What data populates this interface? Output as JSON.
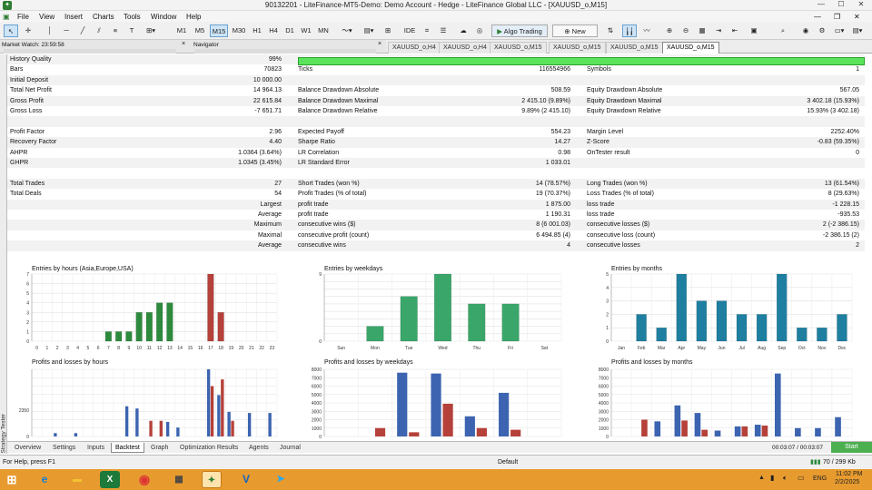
{
  "window": {
    "title": "90132201 - LiteFinance-MT5-Demo: Demo Account - Hedge - LiteFinance Global LLC - [XAUUSD_o,M15]"
  },
  "menu": [
    "File",
    "View",
    "Insert",
    "Charts",
    "Tools",
    "Window",
    "Help"
  ],
  "toolbar": {
    "timeframes": [
      "M1",
      "M5",
      "M15",
      "M30",
      "H1",
      "H4",
      "D1",
      "W1",
      "MN"
    ],
    "active_timeframe": "M15",
    "algo_trading": "Algo Trading",
    "new_order": "New Order"
  },
  "panels": {
    "market_watch": "Market Watch: 23:59:58",
    "navigator": "Navigator"
  },
  "doc_tabs": [
    "XAUUSD_o,H4",
    "XAUUSD_o,H4",
    "XAUUSD_o,M15",
    "XAUUSD_o,M15",
    "XAUUSD_o,M15",
    "XAUUSD_o,M15"
  ],
  "report": {
    "history_quality": {
      "label": "History Quality",
      "value": "99%"
    },
    "rows": [
      {
        "c1l": "Bars",
        "c1v": "70823",
        "c2l": "Ticks",
        "c2v": "116554966",
        "c3l": "Symbols",
        "c3v": "1"
      },
      {
        "c1l": "Initial Deposit",
        "c1v": "10 000.00",
        "c2l": "",
        "c2v": "",
        "c3l": "",
        "c3v": ""
      },
      {
        "c1l": "Total Net Profit",
        "c1v": "14 964.13",
        "c2l": "Balance Drawdown Absolute",
        "c2v": "508.59",
        "c3l": "Equity Drawdown Absolute",
        "c3v": "567.05"
      },
      {
        "c1l": "Gross Profit",
        "c1v": "22 615.84",
        "c2l": "Balance Drawdown Maximal",
        "c2v": "2 415.10 (9.89%)",
        "c3l": "Equity Drawdown Maximal",
        "c3v": "3 402.18 (15.93%)"
      },
      {
        "c1l": "Gross Loss",
        "c1v": "-7 651.71",
        "c2l": "Balance Drawdown Relative",
        "c2v": "9.89% (2 415.10)",
        "c3l": "Equity Drawdown Relative",
        "c3v": "15.93% (3 402.18)"
      },
      {
        "c1l": "",
        "c1v": "",
        "c2l": "",
        "c2v": "",
        "c3l": "",
        "c3v": ""
      },
      {
        "c1l": "Profit Factor",
        "c1v": "2.96",
        "c2l": "Expected Payoff",
        "c2v": "554.23",
        "c3l": "Margin Level",
        "c3v": "2252.40%"
      },
      {
        "c1l": "Recovery Factor",
        "c1v": "4.40",
        "c2l": "Sharpe Ratio",
        "c2v": "14.27",
        "c3l": "Z-Score",
        "c3v": "-0.83 (59.35%)"
      },
      {
        "c1l": "AHPR",
        "c1v": "1.0364 (3.64%)",
        "c2l": "LR Correlation",
        "c2v": "0.98",
        "c3l": "OnTester result",
        "c3v": "0"
      },
      {
        "c1l": "GHPR",
        "c1v": "1.0345 (3.45%)",
        "c2l": "LR Standard Error",
        "c2v": "1 033.01",
        "c3l": "",
        "c3v": ""
      },
      {
        "c1l": "",
        "c1v": "",
        "c2l": "",
        "c2v": "",
        "c3l": "",
        "c3v": ""
      },
      {
        "c1l": "Total Trades",
        "c1v": "27",
        "c2l": "Short Trades (won %)",
        "c2v": "14 (78.57%)",
        "c3l": "Long Trades (won %)",
        "c3v": "13 (61.54%)"
      },
      {
        "c1l": "Total Deals",
        "c1v": "54",
        "c2l": "Profit Trades (% of total)",
        "c2v": "19 (70.37%)",
        "c3l": "Loss Trades (% of total)",
        "c3v": "8 (29.63%)"
      },
      {
        "c1l": "Largest",
        "c1v": "",
        "c2l": "profit trade",
        "c2v": "1 875.00",
        "c3l": "loss trade",
        "c3v": "-1 228.15",
        "indent": true
      },
      {
        "c1l": "Average",
        "c1v": "",
        "c2l": "profit trade",
        "c2v": "1 190.31",
        "c3l": "loss trade",
        "c3v": "-935.53",
        "indent": true
      },
      {
        "c1l": "Maximum",
        "c1v": "",
        "c2l": "consecutive wins ($)",
        "c2v": "8 (6 001.03)",
        "c3l": "consecutive losses ($)",
        "c3v": "2 (-2 386.15)",
        "indent": true
      },
      {
        "c1l": "Maximal",
        "c1v": "",
        "c2l": "consecutive profit (count)",
        "c2v": "6 494.85 (4)",
        "c3l": "consecutive loss (count)",
        "c3v": "-2 386.15 (2)",
        "indent": true
      },
      {
        "c1l": "Average",
        "c1v": "",
        "c2l": "consecutive wins",
        "c2v": "4",
        "c3l": "consecutive losses",
        "c3v": "2",
        "indent": true
      }
    ]
  },
  "chart_data": [
    {
      "type": "bar",
      "title": "Entries by hours (Asia,Europe,USA)",
      "categories": [
        "0",
        "1",
        "2",
        "3",
        "4",
        "5",
        "6",
        "7",
        "8",
        "9",
        "10",
        "11",
        "12",
        "13",
        "14",
        "15",
        "16",
        "17",
        "18",
        "19",
        "20",
        "21",
        "22",
        "23"
      ],
      "series": [
        {
          "values": [
            0,
            0,
            0,
            0,
            0,
            0,
            0,
            1,
            1,
            1,
            3,
            3,
            4,
            4,
            0,
            0,
            0,
            7,
            3,
            0,
            0,
            0,
            0,
            0
          ],
          "colors": [
            "g",
            "g",
            "g",
            "g",
            "g",
            "g",
            "g",
            "g",
            "g",
            "g",
            "g",
            "g",
            "g",
            "g",
            "g",
            "g",
            "g",
            "r",
            "r",
            "g",
            "g",
            "g",
            "g",
            "g"
          ]
        }
      ],
      "ylim": [
        0,
        7
      ],
      "yticks": [
        "0",
        "1",
        "2",
        "3",
        "4",
        "5",
        "6",
        "7"
      ]
    },
    {
      "type": "bar",
      "title": "Entries by weekdays",
      "categories": [
        "Sun",
        "Mon",
        "Tue",
        "Wed",
        "Thu",
        "Fri",
        "Sat"
      ],
      "series": [
        {
          "values": [
            0,
            2,
            6,
            9,
            5,
            5,
            0
          ]
        }
      ],
      "ylim": [
        0,
        9
      ],
      "yticks": [
        "0",
        "9"
      ]
    },
    {
      "type": "bar",
      "title": "Entries by months",
      "categories": [
        "Jan",
        "Feb",
        "Mar",
        "Apr",
        "May",
        "Jun",
        "Jul",
        "Aug",
        "Sep",
        "Oct",
        "Nov",
        "Dec"
      ],
      "series": [
        {
          "values": [
            0,
            2,
            1,
            5,
            3,
            3,
            2,
            2,
            5,
            1,
            1,
            2
          ]
        }
      ],
      "ylim": [
        0,
        5
      ],
      "yticks": [
        "0",
        "1",
        "2",
        "3",
        "4",
        "5"
      ]
    },
    {
      "type": "bar",
      "title": "Profits and losses by hours",
      "categories": [
        "0",
        "1",
        "2",
        "3",
        "4",
        "5",
        "6",
        "7",
        "8",
        "9",
        "10",
        "11",
        "12",
        "13",
        "14",
        "15",
        "16",
        "17",
        "18",
        "19",
        "20",
        "21",
        "22",
        "23"
      ],
      "series": [
        {
          "name": "profit",
          "values": [
            0,
            0,
            300,
            0,
            300,
            0,
            0,
            0,
            0,
            2700,
            2500,
            0,
            0,
            1300,
            800,
            0,
            0,
            6000,
            3700,
            2200,
            0,
            2100,
            0,
            2100
          ]
        },
        {
          "name": "loss",
          "values": [
            0,
            0,
            0,
            0,
            0,
            0,
            0,
            0,
            0,
            0,
            0,
            1400,
            1400,
            0,
            0,
            0,
            0,
            4500,
            5100,
            1400,
            0,
            0,
            0,
            0
          ]
        }
      ],
      "ylim": [
        0,
        6000
      ],
      "yticks": [
        "0",
        "2350"
      ]
    },
    {
      "type": "bar",
      "title": "Profits and losses by weekdays",
      "categories": [
        "Sun",
        "Mon",
        "Tue",
        "Wed",
        "Thu",
        "Fri",
        "Sat"
      ],
      "series": [
        {
          "name": "profit",
          "values": [
            0,
            0,
            7600,
            7500,
            2400,
            5200,
            0
          ]
        },
        {
          "name": "loss",
          "values": [
            0,
            1000,
            500,
            3900,
            1000,
            800,
            0
          ]
        }
      ],
      "ylim": [
        0,
        8000
      ],
      "yticks": [
        "0",
        "1000",
        "2000",
        "3000",
        "4000",
        "5000",
        "6000",
        "7000",
        "8000"
      ]
    },
    {
      "type": "bar",
      "title": "Profits and losses by months",
      "categories": [
        "Jan",
        "Feb",
        "Mar",
        "Apr",
        "May",
        "Jun",
        "Jul",
        "Aug",
        "Sep",
        "Oct",
        "Nov",
        "Dec"
      ],
      "series": [
        {
          "name": "profit",
          "values": [
            0,
            0,
            1800,
            3700,
            2800,
            700,
            1200,
            1400,
            7500,
            1000,
            1000,
            2300
          ]
        },
        {
          "name": "loss",
          "values": [
            0,
            2000,
            0,
            1900,
            800,
            0,
            1200,
            1300,
            0,
            0,
            0,
            0
          ]
        }
      ],
      "ylim": [
        0,
        8000
      ],
      "yticks": [
        "0",
        "1000",
        "2000",
        "3000",
        "4000",
        "5000",
        "6000",
        "7000",
        "8000"
      ]
    }
  ],
  "bottom_tabs": [
    "Overview",
    "Settings",
    "Inputs",
    "Backtest",
    "Graph",
    "Optimization Results",
    "Agents",
    "Journal"
  ],
  "active_bottom_tab": "Backtest",
  "tester": {
    "side_label": "Strategy Tester",
    "timer": "00:03:07 / 00:03:07",
    "start": "Start"
  },
  "statusbar": {
    "help": "For Help, press F1",
    "profile": "Default",
    "traffic": "70 / 299 Kb"
  },
  "taskbar": {
    "lang": "ENG",
    "time": "11:02 PM",
    "date": "2/2/2025"
  },
  "colors": {
    "green": "#2e8b3e",
    "red": "#b5413a",
    "teal": "#1e7fa0",
    "blue": "#3c64b0",
    "loss": "#b5413a"
  }
}
